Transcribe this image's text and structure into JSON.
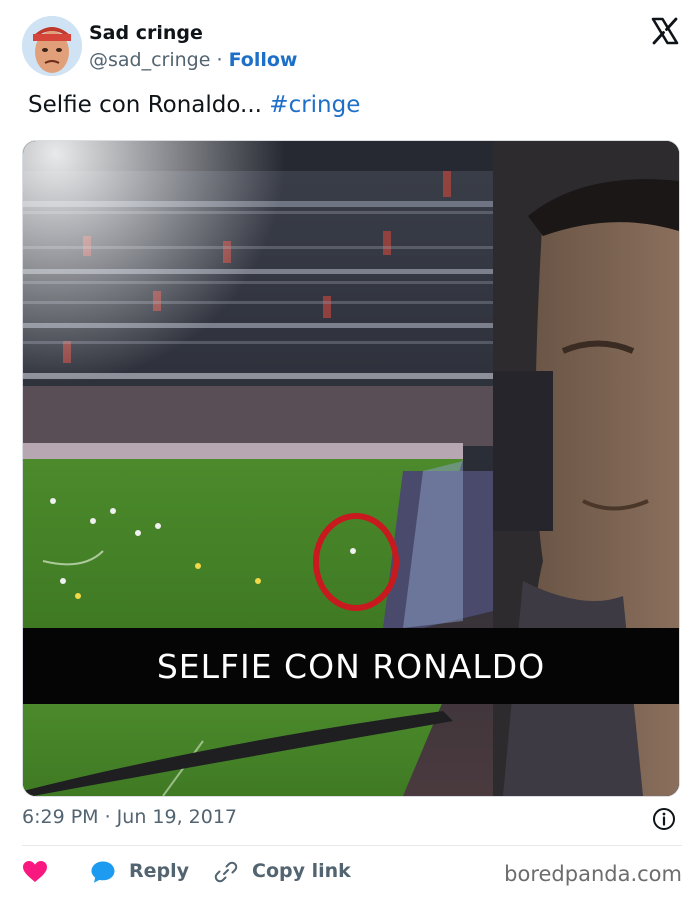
{
  "user": {
    "display_name": "Sad cringe",
    "handle": "@sad_cringe",
    "separator": "·",
    "follow_label": "Follow"
  },
  "tweet": {
    "text": "Selfie con Ronaldo...",
    "hashtag": "#cringe"
  },
  "media": {
    "caption": "SELFIE CON RONALDO"
  },
  "meta": {
    "timestamp": "6:29 PM · Jun 19, 2017"
  },
  "actions": {
    "reply_label": "Reply",
    "copy_link_label": "Copy link"
  },
  "watermark": "boredpanda.com",
  "colors": {
    "accent": "#1d6fc9",
    "like": "#f91880",
    "secondary_text": "#536471"
  },
  "icons": {
    "platform": "x-logo-icon",
    "like": "heart-icon",
    "reply": "speech-bubble-icon",
    "copy_link": "link-icon",
    "info": "info-icon"
  }
}
